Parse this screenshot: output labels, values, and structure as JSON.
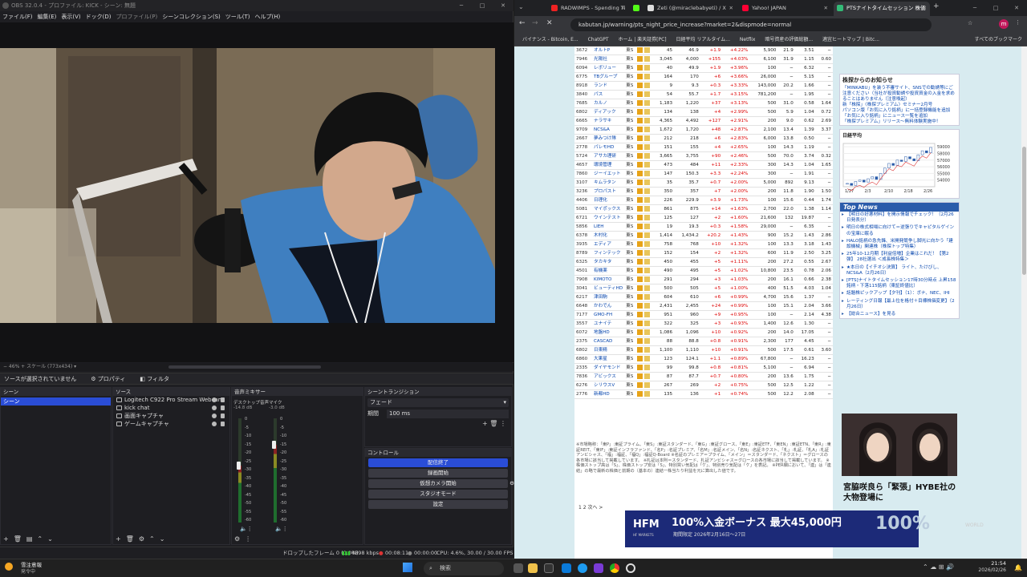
{
  "obs": {
    "title": "OBS 32.0.4 - プロファイル: KICK - シーン: 無題",
    "menu": [
      "ファイル(F)",
      "編集(E)",
      "表示(V)",
      "ドック(D)",
      "プロファイル(P)",
      "シーンコレクション(S)",
      "ツール(T)",
      "ヘルプ(H)"
    ],
    "preview_bar": "−  46%  +   スケール (773x434)   ▾",
    "no_source": "ソースが選択されていません",
    "properties_btn": "プロパティ",
    "filters_btn": "フィルタ",
    "scenes_header": "シーン",
    "scenes": [
      "シーン"
    ],
    "sources_header": "ソース",
    "sources": [
      "Logitech C922 Pro Stream Webcam",
      "kick chat",
      "画面キャプチャ",
      "ゲームキャプチャ"
    ],
    "mixer_header": "音声ミキサー",
    "mixer_channels": [
      {
        "name": "デスクトップ音声",
        "db": "-14.8 dB",
        "level": 0.55
      },
      {
        "name": "マイク",
        "db": "-3.0 dB",
        "level": 0.75
      }
    ],
    "mixer_ticks": [
      "0",
      "-5",
      "-10",
      "-15",
      "-20",
      "-25",
      "-30",
      "-35",
      "-40",
      "-45",
      "-50",
      "-55",
      "-60"
    ],
    "transitions_header": "シーントランジション",
    "transition_type": "フェード",
    "duration_label": "期間",
    "duration_value": "100 ms",
    "controls_header": "コントロール",
    "controls": [
      "配信終了",
      "録画開始",
      "仮想カメラ開始",
      "スタジオモード",
      "設定"
    ],
    "status": {
      "dropped": "ドロップしたフレーム 0 (0.0%)",
      "bitrate": "4898 kbps",
      "live_time": "00:08:11",
      "rec_time": "00:00:00",
      "cpu": "CPU: 4.6%, 30.00 / 30.00 FPS"
    }
  },
  "browser": {
    "tabs": [
      {
        "title": "RADWIMPS - Spending Ti",
        "color": "#e22"
      },
      {
        "title": "",
        "color": "#53fc18"
      },
      {
        "title": "Zeti (@miraclebabyeti) / X",
        "color": "#ddd"
      },
      {
        "title": "Yahoo! JAPAN",
        "color": "#f03"
      },
      {
        "title": "PTSナイトタイムセッション 株価上",
        "color": "#3b7"
      }
    ],
    "url": "kabutan.jp/warning/pts_night_price_increase?market=2&dispmode=normal",
    "bookmarks": [
      "バイナンス - Bitcoin, E...",
      "ChatGPT",
      "ホーム | 楽天証券[PC]",
      "日経平均 リアルタイム...",
      "Netflix",
      "暗号資産の評価総額...",
      "適宜ヒートマップ | Bitc...",
      "すべてのブックマーク"
    ],
    "stocks": [
      [
        "3672",
        "オルトP",
        "東S",
        "45",
        "46.9",
        "+1.9",
        "+4.22%",
        "5,900",
        "21.9",
        "3.51",
        "−"
      ],
      [
        "7946",
        "光陽社",
        "東S",
        "3,045",
        "4,000",
        "+155",
        "+4.03%",
        "6,100",
        "31.9",
        "1.15",
        "0.60"
      ],
      [
        "6094",
        "レボリュー",
        "東S",
        "40",
        "49.9",
        "+1.9",
        "+3.96%",
        "100",
        "−",
        "6.32",
        "−"
      ],
      [
        "6775",
        "TBグループ",
        "東S",
        "164",
        "170",
        "+6",
        "+3.66%",
        "26,000",
        "−",
        "5.15",
        "−"
      ],
      [
        "8918",
        "ランド",
        "東S",
        "9",
        "9.3",
        "+0.3",
        "+3.33%",
        "143,000",
        "20.2",
        "1.66",
        "−"
      ],
      [
        "3840",
        "パス",
        "東S",
        "54",
        "55.7",
        "+1.7",
        "+3.15%",
        "781,200",
        "−",
        "1.95",
        "−"
      ],
      [
        "7685",
        "カルノ",
        "東S",
        "1,183",
        "1,220",
        "+37",
        "+3.13%",
        "500",
        "31.0",
        "0.58",
        "1.64"
      ],
      [
        "6802",
        "ディアック",
        "東S",
        "134",
        "138",
        "+4",
        "+2.99%",
        "500",
        "5.9",
        "1.04",
        "0.72"
      ],
      [
        "6665",
        "ナラサキ",
        "東S",
        "4,365",
        "4,492",
        "+127",
        "+2.91%",
        "200",
        "9.0",
        "0.62",
        "2.69"
      ],
      [
        "9709",
        "NCS&A",
        "東S",
        "1,672",
        "1,720",
        "+48",
        "+2.87%",
        "2,100",
        "13.4",
        "1.39",
        "3.37"
      ],
      [
        "2667",
        "夢みつけ隊",
        "東S",
        "212",
        "218",
        "+6",
        "+2.83%",
        "6,000",
        "13.8",
        "0.50",
        "−"
      ],
      [
        "2778",
        "パレモHD",
        "東S",
        "151",
        "155",
        "+4",
        "+2.65%",
        "100",
        "14.3",
        "1.19",
        "−"
      ],
      [
        "5724",
        "アサカ理研",
        "東S",
        "3,665",
        "3,755",
        "+90",
        "+2.46%",
        "500",
        "70.0",
        "3.74",
        "0.32"
      ],
      [
        "4657",
        "環境管理",
        "東S",
        "473",
        "484",
        "+11",
        "+2.33%",
        "300",
        "14.3",
        "1.04",
        "1.65"
      ],
      [
        "7860",
        "ジーイエット",
        "東S",
        "147",
        "150.3",
        "+3.3",
        "+2.24%",
        "300",
        "−",
        "1.91",
        "−"
      ],
      [
        "3107",
        "キムラタン",
        "東S",
        "35",
        "35.7",
        "+0.7",
        "+2.00%",
        "5,000",
        "892",
        "9.13",
        "−"
      ],
      [
        "3236",
        "プロパスト",
        "東S",
        "350",
        "357",
        "+7",
        "+2.00%",
        "200",
        "11.8",
        "1.90",
        "1.50"
      ],
      [
        "4406",
        "日理化",
        "東S",
        "226",
        "229.9",
        "+3.9",
        "+1.73%",
        "100",
        "15.6",
        "0.44",
        "1.74"
      ],
      [
        "5081",
        "マイポックス",
        "東S",
        "861",
        "875",
        "+14",
        "+1.63%",
        "2,700",
        "22.0",
        "1.38",
        "1.14"
      ],
      [
        "6721",
        "ウインテスト",
        "東S",
        "125",
        "127",
        "+2",
        "+1.60%",
        "21,600",
        "132",
        "19.87",
        "−"
      ],
      [
        "5856",
        "LIEH",
        "東S",
        "19",
        "19.3",
        "+0.3",
        "+1.58%",
        "29,000",
        "−",
        "6.35",
        "−"
      ],
      [
        "6378",
        "木村化",
        "東S",
        "1,414",
        "1,434.2",
        "+20.2",
        "+1.43%",
        "900",
        "15.2",
        "1.43",
        "2.86"
      ],
      [
        "3935",
        "エディア",
        "東S",
        "758",
        "768",
        "+10",
        "+1.32%",
        "100",
        "13.3",
        "3.18",
        "1.43"
      ],
      [
        "8789",
        "フィンテック",
        "東S",
        "152",
        "154",
        "+2",
        "+1.32%",
        "600",
        "11.9",
        "2.50",
        "3.25"
      ],
      [
        "6325",
        "タカキタ",
        "東S",
        "450",
        "455",
        "+5",
        "+1.11%",
        "200",
        "27.2",
        "0.55",
        "2.67"
      ],
      [
        "4501",
        "有機薬",
        "東S",
        "490",
        "495",
        "+5",
        "+1.02%",
        "10,800",
        "23.5",
        "0.78",
        "2.06"
      ],
      [
        "7908",
        "KIMOTO",
        "東S",
        "291",
        "294",
        "+3",
        "+1.03%",
        "200",
        "16.1",
        "0.66",
        "2.38"
      ],
      [
        "3041",
        "ビューティHD",
        "東S",
        "500",
        "505",
        "+5",
        "+1.00%",
        "400",
        "51.5",
        "4.03",
        "1.04"
      ],
      [
        "6217",
        "津田駒",
        "東S",
        "604",
        "610",
        "+6",
        "+0.99%",
        "4,700",
        "15.6",
        "1.37",
        "−"
      ],
      [
        "6648",
        "かわでん",
        "東S",
        "2,431",
        "2,455",
        "+24",
        "+0.99%",
        "100",
        "15.1",
        "2.04",
        "3.66"
      ],
      [
        "7177",
        "GMO-FH",
        "東S",
        "951",
        "960",
        "+9",
        "+0.95%",
        "100",
        "−",
        "2.14",
        "4.38"
      ],
      [
        "3557",
        "ユナイテ",
        "東S",
        "322",
        "325",
        "+3",
        "+0.93%",
        "1,400",
        "12.6",
        "1.30",
        "−"
      ],
      [
        "6072",
        "地盤HD",
        "東S",
        "1,086",
        "1,096",
        "+10",
        "+0.92%",
        "200",
        "14.0",
        "17.05",
        "−"
      ],
      [
        "2375",
        "CASCAD",
        "東S",
        "88",
        "88.8",
        "+0.8",
        "+0.91%",
        "2,300",
        "177",
        "4.45",
        "−"
      ],
      [
        "6802",
        "日東精",
        "東S",
        "1,100",
        "1,110",
        "+10",
        "+0.91%",
        "500",
        "17.5",
        "0.61",
        "3.60"
      ],
      [
        "6860",
        "大果星",
        "東S",
        "123",
        "124.1",
        "+1.1",
        "+0.89%",
        "67,800",
        "−",
        "16.23",
        "−"
      ],
      [
        "2335",
        "ダイヤモンド",
        "東S",
        "99",
        "99.8",
        "+0.8",
        "+0.81%",
        "5,100",
        "−",
        "6.94",
        "−"
      ],
      [
        "7836",
        "アビックス",
        "東S",
        "87",
        "87.7",
        "+0.7",
        "+0.80%",
        "200",
        "13.6",
        "1.75",
        "−"
      ],
      [
        "6276",
        "シリウスV",
        "東S",
        "267",
        "269",
        "+2",
        "+0.75%",
        "500",
        "12.5",
        "1.22",
        "−"
      ],
      [
        "2776",
        "新都HD",
        "東S",
        "135",
        "136",
        "+1",
        "+0.74%",
        "500",
        "12.2",
        "2.08",
        "−"
      ]
    ],
    "notes": "※市場略称：「東P」:東証プライム、「東S」:東証スタンダード、「東G」:東証グロース、「東E」:東証ETF、「東EN」:東証ETN、「東R」:東証REIT、「東IF」:東証インフラファンド、「名P」:名証プレミア、「名M」:名証メイン、「名N」:名証ネクスト、「札」:札証、「札A」:札証アンビシャス、「福」:福証、「福Q」:福証Q-Board ※名証のプレミア＝プライム、「メイン」＝スタンダード、「ネクスト」＝グロースの各市場に該当して掲載しています。 ※札証は本則＝スタンダード、札証アンビシャス＝グロースの各市場に該当して掲載しています。 ※株価ストップ高は「S」、株価ストップ安は「S」、特別買い気配は「ケ」、特別売り気配は「ケ」を表記。 ※PER欄において、「連」は「連結」の略で最新の株価と前期の（基本の）連結一株当たり利益を元に算出した値です。",
    "pager": "1  2  次へ >",
    "sidebar": {
      "notice_title": "株探からのお知らせ",
      "notice_items": [
        "「MINKABU」を装う不審サイト、SNSでの勧誘等にご注意ください（当社が投資勧誘や投資資金の入金を求めることはありません（注意喚起）",
        "新「株探」〈株探プレミアム〉セミナー2月号",
        "パソコン版「お気に入り銘柄」に一括登録機能を追加",
        "「お気に入り銘柄」にニュース一覧を追加",
        "「株探プレミアム」リリース〜無料体験実施中！"
      ],
      "nikkei_label": "日経平均",
      "nikkei_y": [
        "59000",
        "58000",
        "57000",
        "56000",
        "55000",
        "54000"
      ],
      "nikkei_x": [
        "1/27",
        "2/3",
        "2/10",
        "2/18",
        "2/26"
      ],
      "nikkei_series": [
        53500,
        53200,
        53800,
        54000,
        53700,
        54200,
        54500,
        54100,
        55000,
        55800,
        56500,
        56200,
        57000,
        56800,
        57500,
        57200,
        56900,
        57800,
        58400,
        58100,
        58900
      ],
      "topnews_title": "Top News",
      "topnews": [
        "【明日の好悪材料】を開示情報でチェック！（2月26日発表分）",
        "明日の株式相場に向けて＝逆張りでキャピタルゲインの宝庫に眠る",
        "HALO銘柄の急先鋒、米開発競争し脚光に向かう「建設機械」関連株（株探トップ特集）",
        "25年10-12月期【利益倍増】企業はこれだ！【第2弾】 28社選出 ＜成長株特集＞",
        "★本日の【イチオシ決算】 ライト、たけびし、NCS&A（2月26日）",
        "[PTS]ナイトタイムセッション17時30分時点 上昇158銘柄・下落115銘柄（東証終値比）",
        "話題株ピックアップ【夕刊】（1）：ボナ、NEC、IHI",
        "レーティング日報【最上位を格付＋目標株価変更】（2月26日）",
        "【総合ニュース】を見る"
      ],
      "promo_title": "宮脇咲良ら「緊張」HYBE社の大物登場に",
      "promo_side": "WORLD"
    },
    "ad": {
      "logo": "HFM",
      "logo_sub": "HF MARKETS",
      "headline": "100%入金ボーナス 最大45,000円",
      "period": "期間限定 2026年2月16日〜27日",
      "pct": "100%"
    }
  },
  "taskbar": {
    "weather_title": "雪注意報",
    "weather_sub": "発令中",
    "search_placeholder": "検索",
    "time": "21:54",
    "date": "2026/02/26"
  }
}
